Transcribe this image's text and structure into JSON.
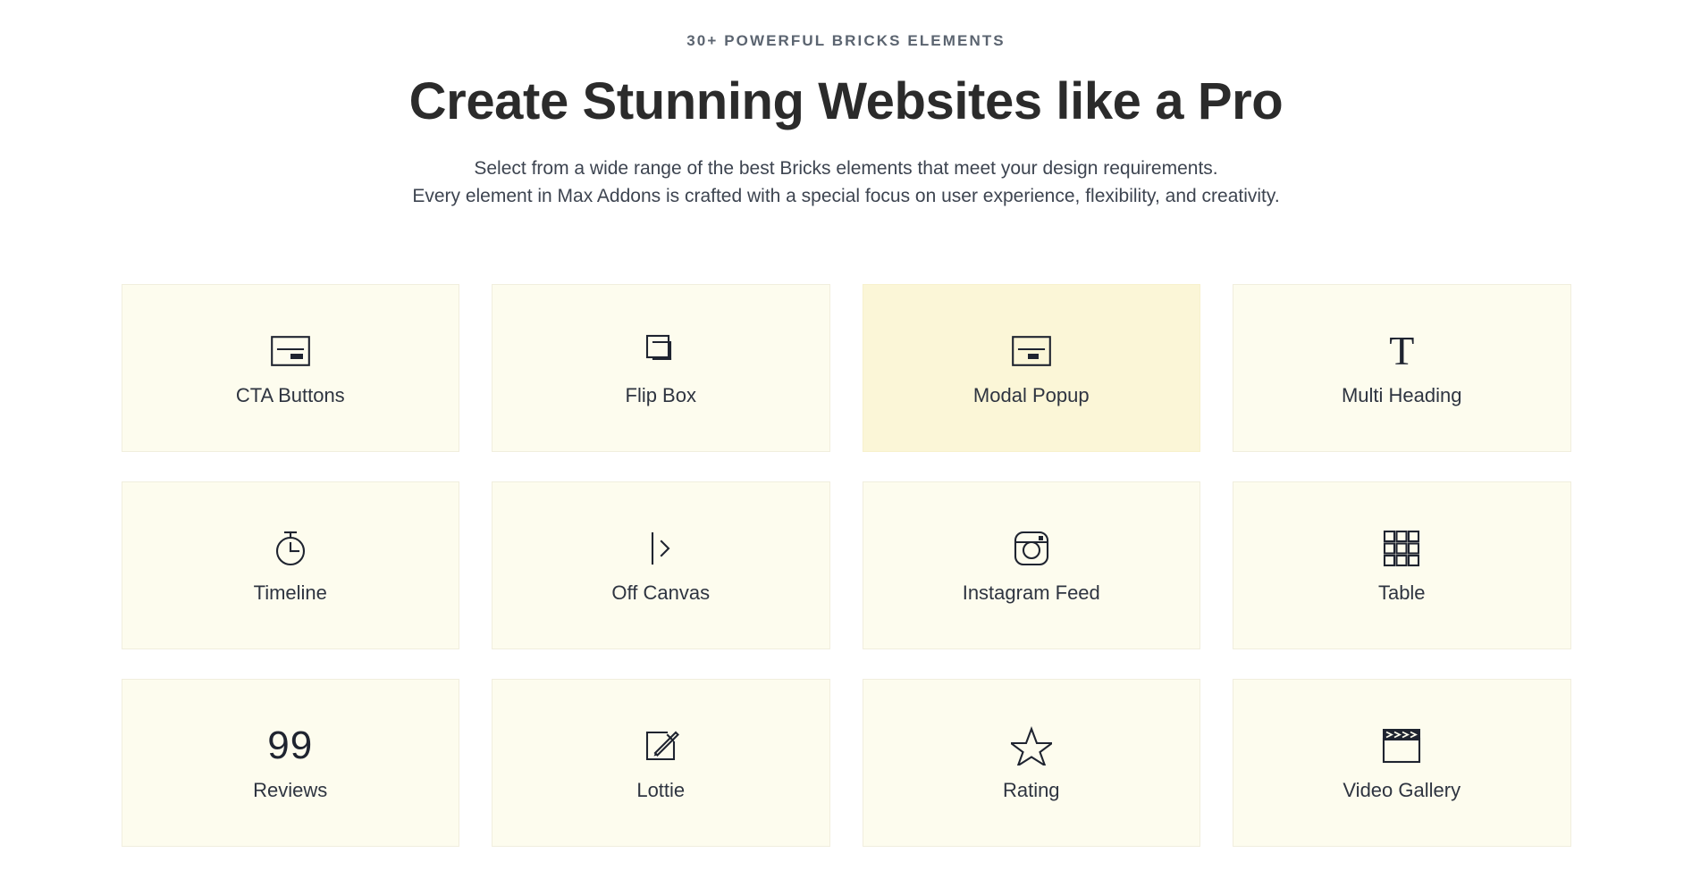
{
  "hero": {
    "eyebrow": "30+ Powerful Bricks Elements",
    "headline": "Create Stunning Websites like a Pro",
    "subcopy_line1": "Select from a wide range of the best Bricks elements that meet your design requirements.",
    "subcopy_line2": "Every element in Max Addons is crafted with a special focus on user experience, flexibility, and creativity."
  },
  "colors": {
    "card_background": "#FDFCEE",
    "card_background_active": "#FBF6D7",
    "card_border": "#F1EEDE",
    "heading_text": "#2B2B2B",
    "eyebrow_text": "#5B6470",
    "body_text": "#3D4450",
    "icon": "#1F2430",
    "page_background": "#FFFFFF"
  },
  "grid": {
    "columns": 4,
    "rows": 3,
    "cards": [
      {
        "label": "CTA Buttons",
        "icon": "cta-button-icon",
        "active": false
      },
      {
        "label": "Flip Box",
        "icon": "flip-box-icon",
        "active": false
      },
      {
        "label": "Modal Popup",
        "icon": "modal-popup-icon",
        "active": true
      },
      {
        "label": "Multi Heading",
        "icon": "multi-heading-icon",
        "active": false
      },
      {
        "label": "Timeline",
        "icon": "stopwatch-icon",
        "active": false
      },
      {
        "label": "Off Canvas",
        "icon": "off-canvas-icon",
        "active": false
      },
      {
        "label": "Instagram Feed",
        "icon": "instagram-icon",
        "active": false
      },
      {
        "label": "Table",
        "icon": "table-grid-icon",
        "active": false
      },
      {
        "label": "Reviews",
        "icon": "quote-99-icon",
        "active": false
      },
      {
        "label": "Lottie",
        "icon": "pencil-square-icon",
        "active": false
      },
      {
        "label": "Rating",
        "icon": "star-outline-icon",
        "active": false
      },
      {
        "label": "Video Gallery",
        "icon": "clapperboard-icon",
        "active": false
      }
    ]
  }
}
